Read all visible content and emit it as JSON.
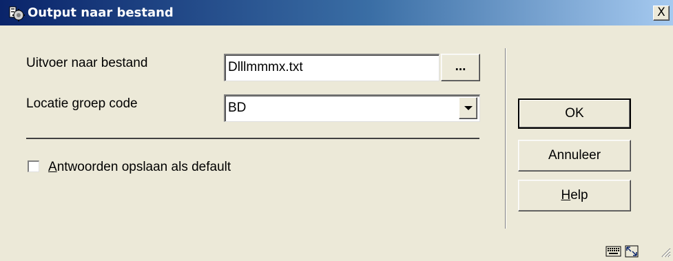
{
  "window": {
    "title": "Output naar bestand",
    "close_label": "X"
  },
  "form": {
    "output_label": "Uitvoer naar bestand",
    "output_value": "Dlllmmmx.txt",
    "browse_label": "...",
    "location_label": "Locatie groep code",
    "location_value": "BD",
    "save_checkbox": {
      "checked": false,
      "mnemonic": "A",
      "label_rest": "ntwoorden opslaan als default"
    }
  },
  "buttons": {
    "ok": "OK",
    "cancel": "Annuleer",
    "help_mnemonic": "H",
    "help_rest": "elp"
  },
  "icons": {
    "app": "app-icon",
    "keyboard": "keyboard-icon",
    "resize": "resize-icon",
    "grip": "size-grip-icon"
  }
}
